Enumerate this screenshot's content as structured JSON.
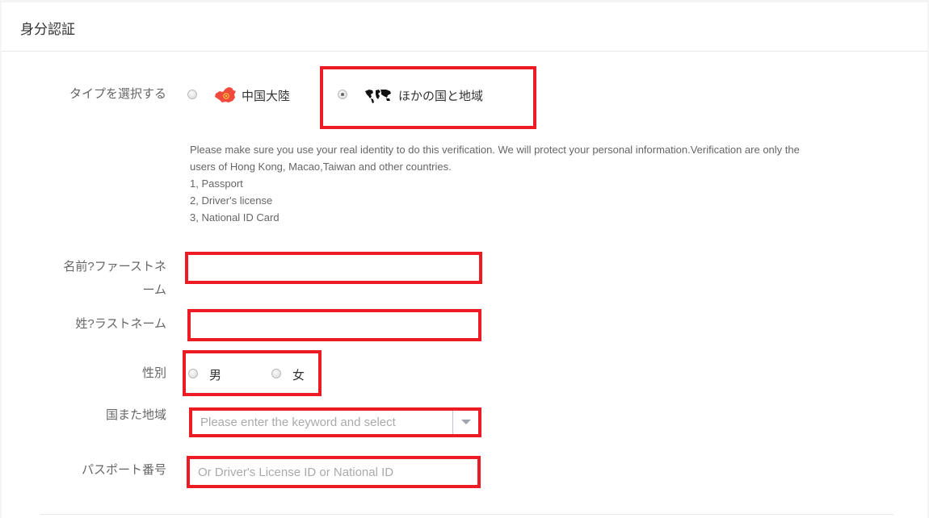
{
  "panel": {
    "title": "身分認証"
  },
  "type_select": {
    "label": "タイプを選択する",
    "options": [
      {
        "label": "中国大陸",
        "icon": "china-map-icon",
        "checked": false
      },
      {
        "label": "ほかの国と地域",
        "icon": "world-map-icon",
        "checked": true
      }
    ]
  },
  "notes": {
    "lines": [
      "Please make sure you use your real identity to do this verification. We will protect your personal information.Verification are only the",
      "users of Hong Kong, Macao,Taiwan and other countries.",
      "1, Passport",
      "2, Driver's license",
      "3, National ID Card"
    ]
  },
  "form": {
    "first_name": {
      "label_line1": "名前?ファーストネ",
      "label_line2": "ーム",
      "value": "",
      "placeholder": ""
    },
    "last_name": {
      "label": "姓?ラストネーム",
      "value": "",
      "placeholder": ""
    },
    "gender": {
      "label": "性別",
      "options": [
        {
          "label": "男",
          "checked": false
        },
        {
          "label": "女",
          "checked": false
        }
      ]
    },
    "country": {
      "label": "国また地域",
      "placeholder": "Please enter the keyword and select",
      "value": ""
    },
    "passport": {
      "label": "パスポート番号",
      "placeholder": "Or Driver's License ID or National ID",
      "value": ""
    }
  },
  "colors": {
    "highlight": "#ed1c24"
  }
}
